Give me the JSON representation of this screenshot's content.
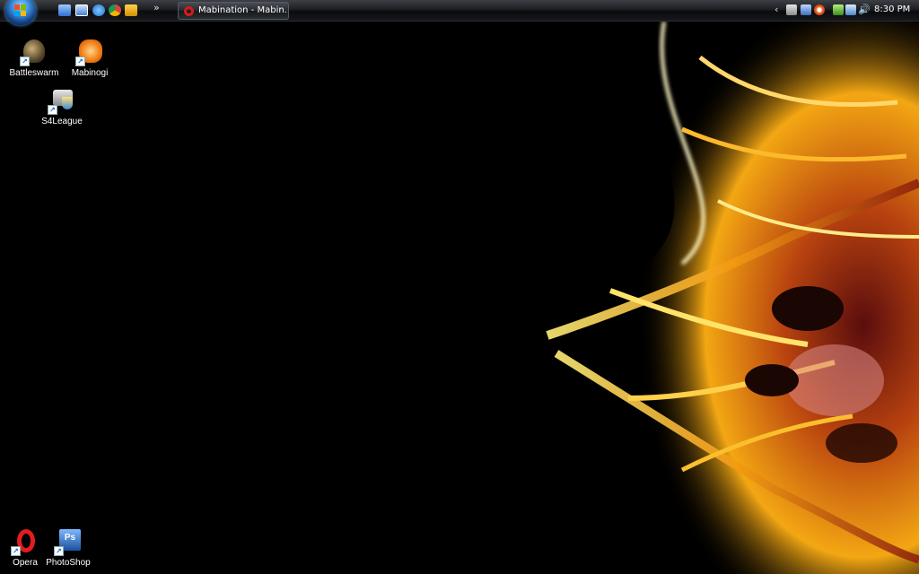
{
  "taskbar": {
    "quick_launch": [
      "show-desktop",
      "switch-windows",
      "internet-explorer",
      "chrome",
      "media-player"
    ],
    "more": "»",
    "task_button": {
      "label": "Mabination - Mabin..."
    },
    "tray_arrow": "‹",
    "clock": "8:30 PM"
  },
  "desktop": {
    "icons": [
      {
        "label": "Battleswarm"
      },
      {
        "label": "Mabinogi"
      },
      {
        "label": "S4League"
      },
      {
        "label": "Opera"
      },
      {
        "label": "PhotoShop"
      }
    ]
  },
  "colors": {
    "accent": "#f7b21e",
    "taskbar": "#1d1f23",
    "desktop": "#000000"
  }
}
